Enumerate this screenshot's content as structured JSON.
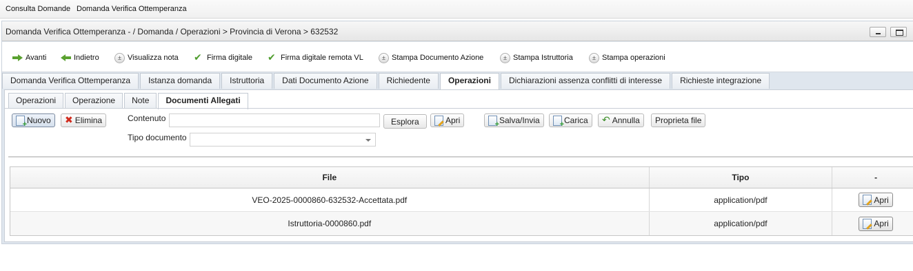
{
  "menubar": {
    "item1": "Consulta Domande",
    "item2": "Domanda Verifica Ottemperanza"
  },
  "window": {
    "title": "Domanda Verifica Ottemperanza - / Domanda / Operazioni > Provincia di Verona > 632532"
  },
  "toolbar": {
    "avanti": "Avanti",
    "indietro": "Indietro",
    "visualizza_nota": "Visualizza nota",
    "firma_digitale": "Firma digitale",
    "firma_remota": "Firma digitale remota VL",
    "stampa_documento": "Stampa Documento Azione",
    "stampa_istruttoria": "Stampa Istruttoria",
    "stampa_operazioni": "Stampa operazioni"
  },
  "tabs": [
    "Domanda Verifica Ottemperanza",
    "Istanza domanda",
    "Istruttoria",
    "Dati Documento Azione",
    "Richiedente",
    "Operazioni",
    "Dichiarazioni assenza conflitti di interesse",
    "Richieste integrazione"
  ],
  "subtabs": [
    "Operazioni",
    "Operazione",
    "Note",
    "Documenti Allegati"
  ],
  "actions": {
    "nuovo": "Nuovo",
    "elimina": "Elimina",
    "contenuto_label": "Contenuto",
    "esplora": "Esplora",
    "apri": "Apri",
    "salva_invia": "Salva/Invia",
    "carica": "Carica",
    "annulla": "Annulla",
    "proprieta": "Proprieta file",
    "tipo_documento_label": "Tipo documento"
  },
  "grid": {
    "headers": {
      "file": "File",
      "tipo": "Tipo",
      "action": "-"
    },
    "rows": [
      {
        "file": "VEO-2025-0000860-632532-Accettata.pdf",
        "tipo": "application/pdf",
        "action": "Apri"
      },
      {
        "file": "Istruttoria-0000860.pdf",
        "tipo": "application/pdf",
        "action": "Apri"
      }
    ]
  }
}
